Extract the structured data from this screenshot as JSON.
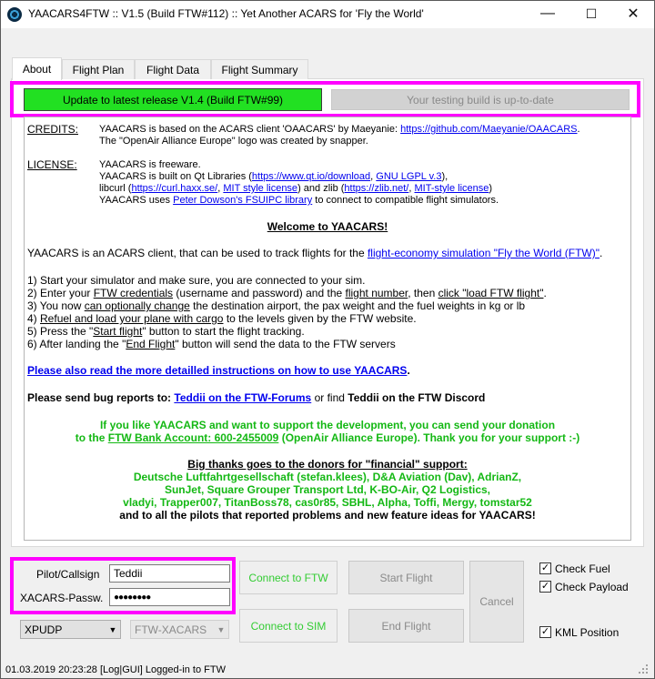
{
  "window": {
    "title": "YAACARS4FTW :: V1.5 (Build FTW#112) :: Yet Another ACARS for 'Fly the World'",
    "minimize": "—",
    "maximize": "☐",
    "close": "✕"
  },
  "tabs": [
    {
      "label": "About"
    },
    {
      "label": "Flight Plan"
    },
    {
      "label": "Flight Data"
    },
    {
      "label": "Flight Summary"
    }
  ],
  "update": {
    "update_label": "Update to latest release V1.4 (Build FTW#99)",
    "testing_label": "Your testing build is up-to-date"
  },
  "about": {
    "credits_label": "CREDITS:",
    "credits_line1_pre": "YAACARS is based on the ACARS client 'OAACARS' by Maeyanie: ",
    "credits_link1": "https://github.com/Maeyanie/OAACARS",
    "credits_line1_post": ".",
    "credits_line2": "The \"OpenAir Alliance Europe\" logo was created by snapper.",
    "license_label": "LICENSE:",
    "license_line1": "YAACARS is freeware.",
    "license_line2_pre": "YAACARS is built on Qt Libraries (",
    "license_link_qt": "https://www.qt.io/download",
    "license_sep1": ", ",
    "license_link_lgpl": "GNU LGPL v.3",
    "license_line2_post": "),",
    "license_line3_pre": "libcurl (",
    "license_link_curl": "https://curl.haxx.se/",
    "license_sep2": ", ",
    "license_link_mit1": "MIT style license",
    "license_line3_mid": ") and zlib (",
    "license_link_zlib": "https://zlib.net/",
    "license_sep3": ", ",
    "license_link_mit2": "MIT-style license",
    "license_line3_post": ")",
    "license_line4_pre": "YAACARS uses ",
    "license_link_fsuipc": "Peter Dowson's FSUIPC library",
    "license_line4_post": " to connect to compatible flight simulators.",
    "welcome": "Welcome to YAACARS!",
    "intro_pre": "YAACARS is an ACARS client, that can be used to track flights for the ",
    "intro_link": "flight-economy simulation \"Fly the World (FTW)\"",
    "intro_post": ".",
    "step1": "1) Start your simulator and make sure, you are connected to your sim.",
    "step2_a": "2) Enter your ",
    "step2_u1": "FTW credentials",
    "step2_b": " (username and password) and the ",
    "step2_u2": "flight number",
    "step2_c": ", then ",
    "step2_u3": "click \"load FTW flight\"",
    "step2_d": ".",
    "step3_a": "3) You now ",
    "step3_u": "can optionally change",
    "step3_b": " the destination airport, the pax weight and the fuel weights in kg or lb",
    "step4_a": "4) ",
    "step4_u": "Refuel and load your plane with cargo",
    "step4_b": " to the levels given by the FTW website.",
    "step5_a": "5) Press the \"",
    "step5_u": "Start flight",
    "step5_b": "\" button to start the flight tracking.",
    "step6_a": "6) After landing the \"",
    "step6_u": "End Flight",
    "step6_b": "\" button will send the data to the FTW servers",
    "instructions_link": "Please also read the more detailled instructions on how to use YAACARS",
    "instructions_post": ".",
    "bug_pre": "Please send bug reports to: ",
    "bug_link": "Teddii on the FTW-Forums",
    "bug_mid": " or find ",
    "bug_bold": "Teddii on the FTW Discord",
    "donate_line1": "If you like YAACARS and want to support the development, you can send your donation",
    "donate_line2_pre": "to the ",
    "donate_line2_u": "FTW Bank Account: 600-2455009",
    "donate_line2_post": " (OpenAir Alliance Europe). Thank you for your support :-)",
    "thanks_heading": "Big thanks goes to the donors for \"financial\" support:",
    "donors_line1": "Deutsche Luftfahrtgesellschaft (stefan.klees), D&A Aviation (Dav), AdrianZ,",
    "donors_line2": "SunJet, Square Grouper Transport Ltd, K-BO-Air, Q2 Logistics,",
    "donors_line3": "vladyi, Trapper007, TitanBoss78, cas0r85,  SBHL, Alpha, Toffi, Mergy, tomstar52",
    "donors_line4": "and to all the pilots that reported problems and new feature ideas for YAACARS!"
  },
  "login": {
    "callsign_label": "Pilot/Callsign",
    "callsign_value": "Teddii",
    "password_label": "XACARS-Passw.",
    "password_value": "●●●●●●●●"
  },
  "buttons": {
    "connect_ftw": "Connect to FTW",
    "connect_sim": "Connect to SIM",
    "start_flight": "Start Flight",
    "end_flight": "End Flight",
    "cancel": "Cancel"
  },
  "selects": {
    "sim_type": "XPUDP",
    "acars_type": "FTW-XACARS"
  },
  "checks": {
    "fuel": {
      "label": "Check Fuel",
      "checked": true
    },
    "payload": {
      "label": "Check Payload",
      "checked": true
    },
    "kml": {
      "label": "KML Position",
      "checked": true
    },
    "check_mark": "✓"
  },
  "status": {
    "text": "01.03.2019 20:23:28 [Log|GUI] Logged-in to FTW"
  }
}
